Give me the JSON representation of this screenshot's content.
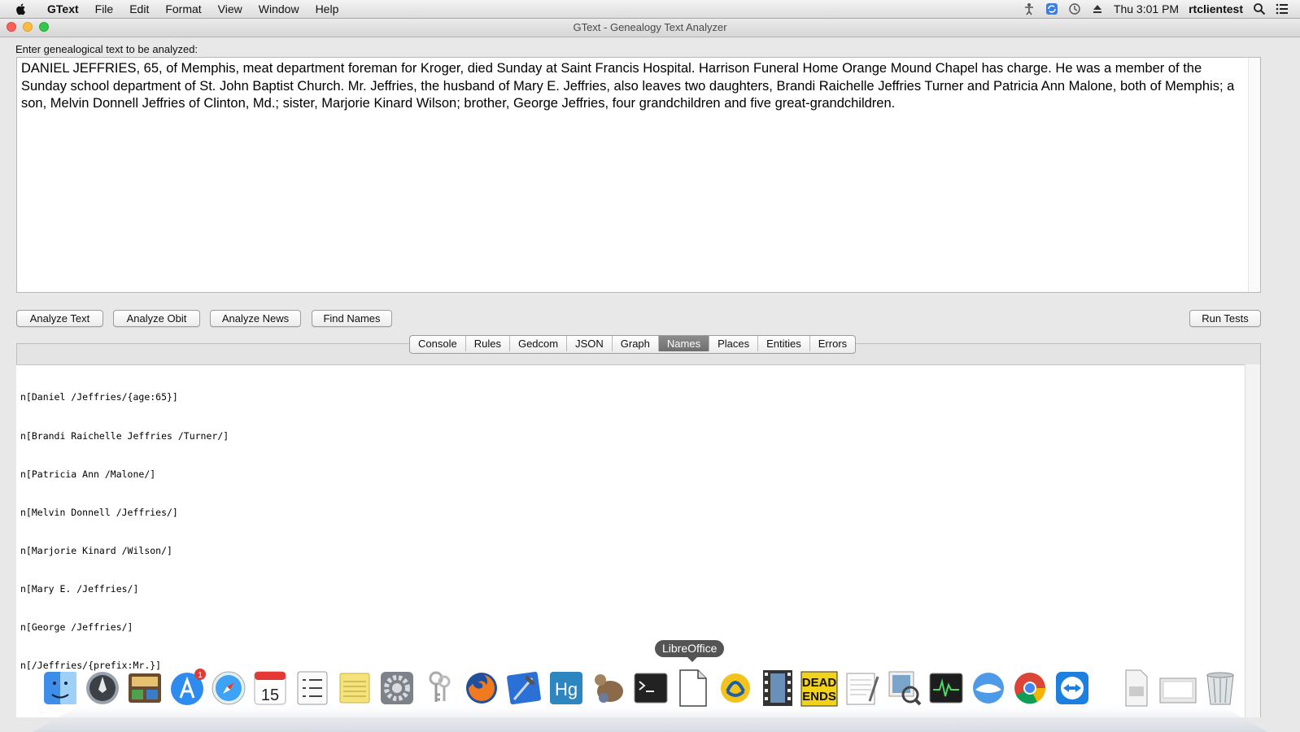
{
  "menubar": {
    "app_name": "GText",
    "menus": [
      "File",
      "Edit",
      "Format",
      "View",
      "Window",
      "Help"
    ],
    "clock": "Thu 3:01 PM",
    "user": "rtclientest",
    "tray_icons": [
      "accessibility-icon",
      "sync-icon",
      "time-machine-icon",
      "eject-icon",
      "spotlight-search-icon",
      "notification-list-icon"
    ]
  },
  "window": {
    "title": "GText - Genealogy Text Analyzer"
  },
  "input": {
    "label": "Enter genealogical text to be analyzed:",
    "text": "DANIEL JEFFRIES, 65, of Memphis, meat department foreman for Kroger, died Sunday at Saint Francis Hospital. Harrison Funeral Home Orange Mound Chapel has charge. He was a member of the Sunday school department of St. John Baptist Church. Mr. Jeffries, the husband of Mary E. Jeffries, also leaves two daughters, Brandi Raichelle Jeffries Turner and Patricia Ann Malone, both of Memphis; a son, Melvin Donnell Jeffries of Clinton, Md.; sister, Marjorie Kinard Wilson; brother, George Jeffries, four grandchildren and five great-grandchildren."
  },
  "buttons": {
    "analyze_text": "Analyze Text",
    "analyze_obit": "Analyze Obit",
    "analyze_news": "Analyze News",
    "find_names": "Find Names",
    "run_tests": "Run Tests"
  },
  "tabs": [
    {
      "label": "Console",
      "active": false
    },
    {
      "label": "Rules",
      "active": false
    },
    {
      "label": "Gedcom",
      "active": false
    },
    {
      "label": "JSON",
      "active": false
    },
    {
      "label": "Graph",
      "active": false
    },
    {
      "label": "Names",
      "active": true
    },
    {
      "label": "Places",
      "active": false
    },
    {
      "label": "Entities",
      "active": false
    },
    {
      "label": "Errors",
      "active": false
    }
  ],
  "output": {
    "lines": [
      "n[Daniel /Jeffries/{age:65}]",
      "n[Brandi Raichelle Jeffries /Turner/]",
      "n[Patricia Ann /Malone/]",
      "n[Melvin Donnell /Jeffries/]",
      "n[Marjorie Kinard /Wilson/]",
      "n[Mary E. /Jeffries/]",
      "n[George /Jeffries/]",
      "n[/Jeffries/{prefix:Mr.}]"
    ]
  },
  "dock": {
    "tooltip": "LibreOffice",
    "apps": [
      "finder-icon",
      "launchpad-icon",
      "photo-browser-icon",
      "app-store-icon",
      "safari-icon",
      "calendar-icon",
      "reminders-icon",
      "stickies-icon",
      "system-preferences-icon",
      "keychain-access-icon",
      "firefox-icon",
      "xcode-icon",
      "mercurial-icon",
      "mouse-app-icon",
      "terminal-icon",
      "libreoffice-icon",
      "openoffice-icon",
      "video-editor-icon",
      "dead-ends-icon",
      "textedit-icon",
      "preview-icon",
      "activity-monitor-icon",
      "mail-client-icon",
      "chrome-icon",
      "teamviewer-icon",
      "documents-folder-icon",
      "downloads-folder-icon",
      "trash-icon"
    ],
    "calendar_day": "15",
    "app_store_badge": "1",
    "dead_ends_label_1": "DEAD",
    "dead_ends_label_2": "ENDS",
    "mercurial_label": "Hg"
  }
}
